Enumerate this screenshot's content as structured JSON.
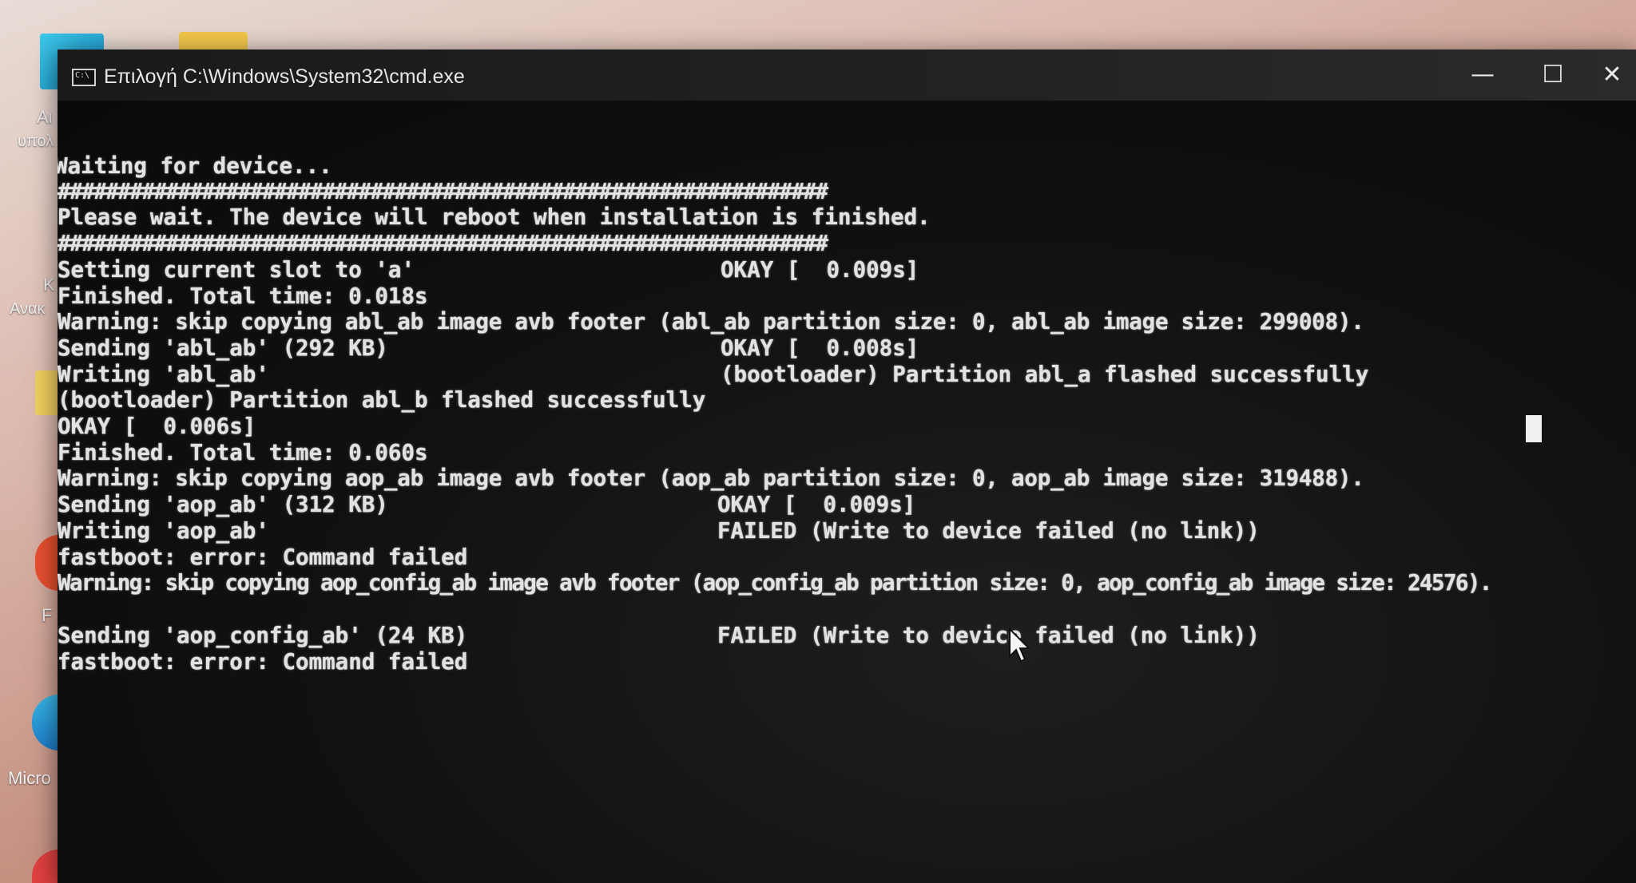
{
  "desktop": {
    "icon_labels": [
      "Αι",
      "υπολ",
      "Κ",
      "Ανακ",
      "F",
      "Micro"
    ]
  },
  "window": {
    "title": "Επιλογή C:\\Windows\\System32\\cmd.exe",
    "minimize_symbol": "—",
    "maximize_symbol": "☐",
    "close_symbol": "✕"
  },
  "console": {
    "lines": [
      "Waiting for device...",
      "################################################################",
      "Please wait. The device will reboot when installation is finished.",
      "################################################################",
      "Setting current slot to 'a'",
      "Finished. Total time: 0.018s",
      "Warning: skip copying abl_ab image avb footer (abl_ab partition size: 0, abl_ab image size: 299008).",
      "Sending 'abl_ab' (292 KB)",
      "Writing 'abl_ab'",
      "(bootloader) Partition abl_b flashed successfully",
      "OKAY [  0.006s]",
      "Finished. Total time: 0.060s",
      "Warning: skip copying aop_ab image avb footer (aop_ab partition size: 0, aop_ab image size: 319488).",
      "Sending 'aop_ab' (312 KB)",
      "Writing 'aop_ab'",
      "fastboot: error: Command failed",
      "Warning: skip copying aop_config_ab image avb footer (aop_config_ab partition size: 0, aop_config_ab image size: 24576).",
      "",
      "Sending 'aop_config_ab' (24 KB)",
      "fastboot: error: Command failed"
    ],
    "status_column": [
      "OKAY [  0.009s]",
      "OKAY [  0.008s]",
      "(bootloader) Partition abl_a flashed successfully",
      "OKAY [  0.009s]",
      "FAILED (Write to device failed (no link))",
      "FAILED (Write to device failed (no link))"
    ]
  }
}
